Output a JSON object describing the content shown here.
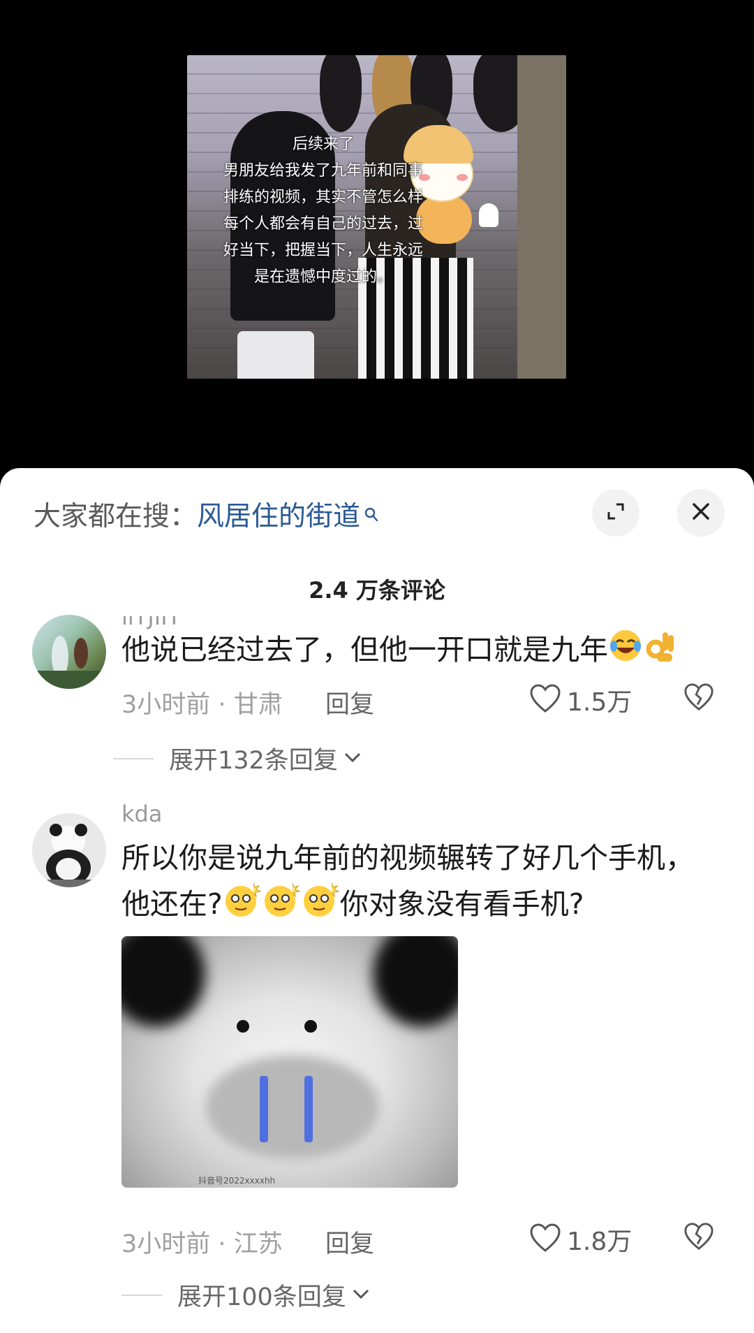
{
  "video": {
    "caption_lines": [
      "后续来了",
      "男朋友给我发了九年前和同事",
      "排练的视频，其实不管怎么样",
      "每个人都会有自己的过去，过",
      "好当下，把握当下，人生永远",
      "是在遗憾中度过的。"
    ]
  },
  "search_bar": {
    "prefix": "大家都在搜：",
    "term": "风居住的街道"
  },
  "header": {
    "comment_count": "2.4 万条评论",
    "expand_icon": "expand-icon",
    "close_icon": "close-icon"
  },
  "comments": [
    {
      "username": "iiTJIIT",
      "text": "他说已经过去了，但他一开口就是九年",
      "emojis": [
        "laughing-crying-emoji",
        "ok-hand-emoji"
      ],
      "time": "3小时前",
      "location": "甘肃",
      "reply_label": "回复",
      "likes": "1.5万",
      "expand_replies": "展开132条回复"
    },
    {
      "username": "kda",
      "text_part1": "所以你是说九年前的视频辗转了好几个手机，",
      "text_part2_a": "他还在?",
      "text_part2_b": "你对象没有看手机?",
      "emojis": [
        "dizzy-face-emoji",
        "dizzy-face-emoji",
        "dizzy-face-emoji"
      ],
      "meme_watermark": "抖音号2022xxxxhh",
      "time": "3小时前",
      "location": "江苏",
      "reply_label": "回复",
      "likes": "1.8万",
      "expand_replies": "展开100条回复"
    }
  ],
  "colors": {
    "search_term": "#2b5a94",
    "meta_gray": "#a0a0a0"
  }
}
